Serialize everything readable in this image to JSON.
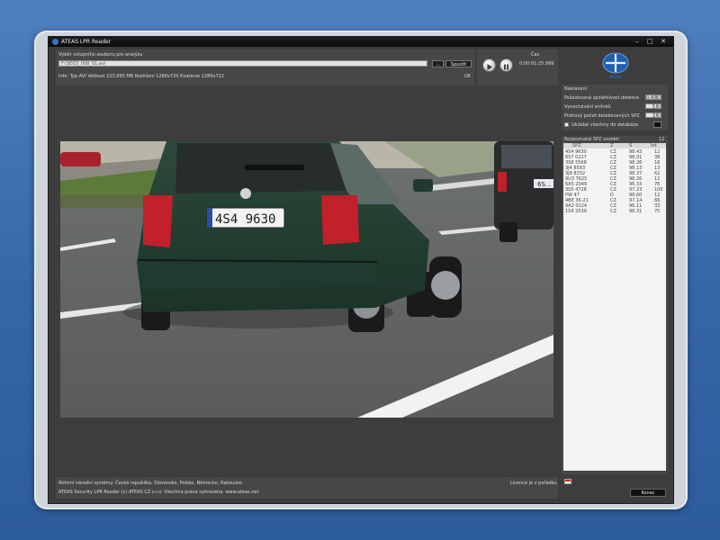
{
  "title": "ATEAS LPR Reader",
  "file_panel": {
    "heading": "Výběr vstupního souboru pro analýzu",
    "path_value": "F:\\SEO3_008_01.avi",
    "browse_label": "...",
    "open_label": "Spustit",
    "info_text": "Info:  Typ AVI  Velikost 223,993 MB  Rozlišení 1280x720  Kvaterze 1280x722",
    "info_status": "OK"
  },
  "time": {
    "label": "Čas",
    "value": "0:00:01:25.999"
  },
  "logo_text": "Ateas",
  "settings": {
    "heading": "Nastavení",
    "rows": [
      {
        "label": "Požadovaná spolehlivost detekce",
        "value": "0.40"
      },
      {
        "label": "Vynechávání snímků",
        "value": "5"
      },
      {
        "label": "Prahový počet detekovaných SPZ",
        "value": "3"
      }
    ],
    "save_label": "Ukládat všechny do databáze"
  },
  "plates": {
    "heading": "Rozpoznané SPZ vozidel",
    "count": "12",
    "columns": [
      "SPZ",
      "Z",
      "S",
      "Int"
    ],
    "rows": [
      [
        "4S4 9630",
        "CZ",
        "98.43",
        "12"
      ],
      [
        "6S7 0227",
        "CZ",
        "98.01",
        "38"
      ],
      [
        "3S8 5568",
        "CZ",
        "98.26",
        "16"
      ],
      [
        "3J4 8593",
        "CZ",
        "98.13",
        "13"
      ],
      [
        "3J9 8332",
        "CZ",
        "98.37",
        "62"
      ],
      [
        "9U3 7625",
        "CZ",
        "98.26",
        "12"
      ],
      [
        "6A5 2049",
        "CZ",
        "96.33",
        "76"
      ],
      [
        "3S5 4728",
        "CZ",
        "97.23",
        "100"
      ],
      [
        "PW 47",
        "D",
        "98.60",
        "12"
      ],
      [
        "4BE 36-21",
        "CZ",
        "97.14",
        "66"
      ],
      [
        "9A2 0124",
        "CZ",
        "96.11",
        "33"
      ],
      [
        "1S4 2539",
        "CZ",
        "96.31",
        "75"
      ]
    ]
  },
  "footer": {
    "line1": "Aktivní národní systémy: Česká republika, Slovensko, Polsko, Německo, Rakousko",
    "line2": "ATEAS Security LPR Reader  (c) ATEAS  CZ s.r.o. Všechna práva vyhrazena. www.ateas.net",
    "license": "Licence je v pořádku"
  },
  "end_label": "Konec",
  "scene": {
    "plate_text": "4S4 9630",
    "plate2_text": "6S..."
  },
  "colors": {
    "window_bg": "#3d3d3d",
    "panel_bg": "#474747",
    "desktop": "#3566a8"
  }
}
